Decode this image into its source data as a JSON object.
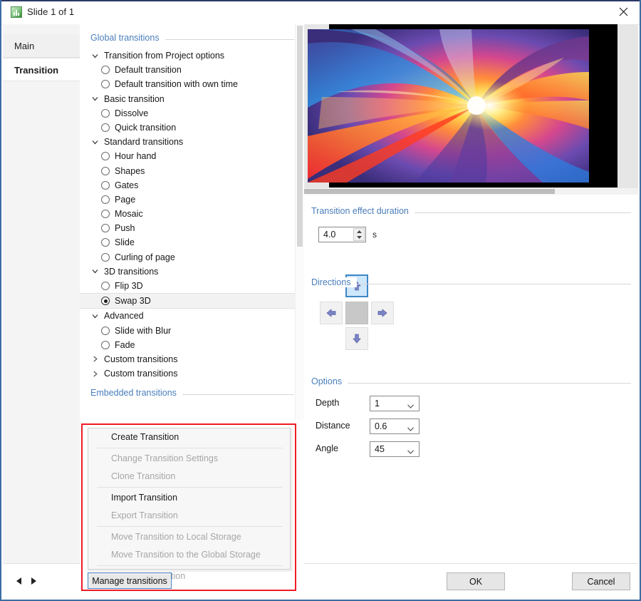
{
  "window": {
    "title": "Slide 1 of 1",
    "app_icon": "chart-icon",
    "close_icon": "close-icon"
  },
  "tabs": [
    {
      "label": "Main",
      "active": false
    },
    {
      "label": "Transition",
      "active": true
    }
  ],
  "nav": {
    "prev_icon": "triangle-left-icon",
    "next_icon": "triangle-right-icon"
  },
  "transitions_panel": {
    "global_heading": "Global transitions",
    "embedded_heading": "Embedded transitions",
    "groups": [
      {
        "label": "Transition from Project options",
        "expanded": true,
        "options": [
          {
            "label": "Default transition",
            "checked": false
          },
          {
            "label": "Default transition with own time",
            "checked": false
          }
        ]
      },
      {
        "label": "Basic transition",
        "expanded": true,
        "options": [
          {
            "label": "Dissolve",
            "checked": false
          },
          {
            "label": "Quick transition",
            "checked": false
          }
        ]
      },
      {
        "label": "Standard transitions",
        "expanded": true,
        "options": [
          {
            "label": "Hour hand",
            "checked": false
          },
          {
            "label": "Shapes",
            "checked": false
          },
          {
            "label": "Gates",
            "checked": false
          },
          {
            "label": "Page",
            "checked": false
          },
          {
            "label": "Mosaic",
            "checked": false
          },
          {
            "label": "Push",
            "checked": false
          },
          {
            "label": "Slide",
            "checked": false
          },
          {
            "label": "Curling of page",
            "checked": false
          }
        ]
      },
      {
        "label": "3D transitions",
        "expanded": true,
        "options": [
          {
            "label": "Flip 3D",
            "checked": false
          },
          {
            "label": "Swap 3D",
            "checked": true
          }
        ]
      },
      {
        "label": "Advanced",
        "expanded": true,
        "options": [
          {
            "label": "Slide with Blur",
            "checked": false
          },
          {
            "label": "Fade",
            "checked": false
          }
        ]
      },
      {
        "label": "Custom transitions",
        "expanded": false,
        "options": []
      },
      {
        "label": "Custom transitions",
        "expanded": false,
        "options": []
      }
    ]
  },
  "context_menu": {
    "items": [
      {
        "label": "Create Transition",
        "enabled": true,
        "separator_after": true
      },
      {
        "label": "Change Transition Settings",
        "enabled": false,
        "separator_after": false
      },
      {
        "label": "Clone Transition",
        "enabled": false,
        "separator_after": true
      },
      {
        "label": "Import Transition",
        "enabled": true,
        "separator_after": false
      },
      {
        "label": "Export Transition",
        "enabled": false,
        "separator_after": true
      },
      {
        "label": "Move Transition to Local Storage",
        "enabled": false,
        "separator_after": false
      },
      {
        "label": "Move Transition to the Global Storage",
        "enabled": false,
        "separator_after": true
      },
      {
        "label": "Remove Transition",
        "enabled": false,
        "separator_after": false
      }
    ]
  },
  "manage_button": {
    "label": "Manage transitions"
  },
  "preview": {
    "alt": "abstract-light-burst-preview"
  },
  "duration": {
    "heading": "Transition effect duration",
    "value": "4.0",
    "unit": "s",
    "spinner_up_icon": "caret-up-icon",
    "spinner_down_icon": "caret-down-icon"
  },
  "directions": {
    "heading": "Directions",
    "buttons": [
      {
        "name": "up",
        "icon": "arrow-up-icon",
        "active": true
      },
      {
        "name": "left",
        "icon": "arrow-left-icon",
        "active": false
      },
      {
        "name": "center",
        "icon": "",
        "active": false
      },
      {
        "name": "right",
        "icon": "arrow-right-icon",
        "active": false
      },
      {
        "name": "down",
        "icon": "arrow-down-icon",
        "active": false
      }
    ]
  },
  "options": {
    "heading": "Options",
    "fields": [
      {
        "label": "Depth",
        "value": "1"
      },
      {
        "label": "Distance",
        "value": "0.6"
      },
      {
        "label": "Angle",
        "value": "45"
      }
    ]
  },
  "footer": {
    "ok_label": "OK",
    "cancel_label": "Cancel"
  },
  "colors": {
    "accent_blue": "#4a7ebb",
    "highlight_red": "#ee1c25",
    "focus_blue": "#3d86c6",
    "window_border": "#3a6ea5"
  }
}
